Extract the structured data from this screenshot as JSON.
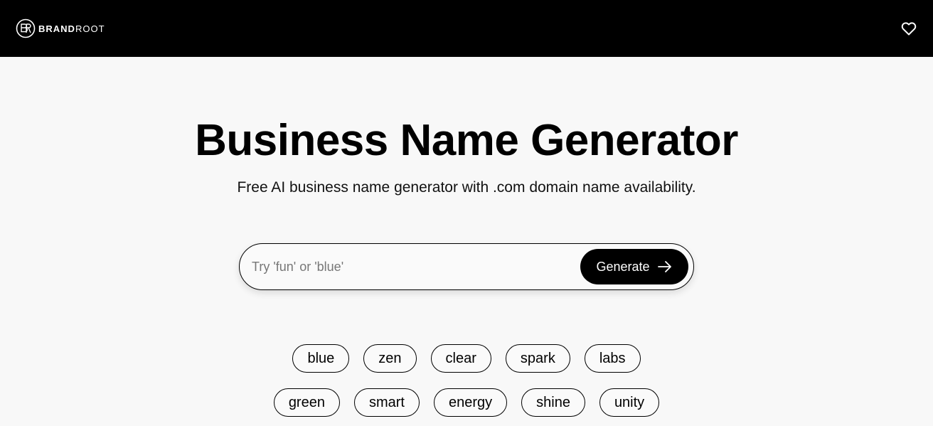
{
  "header": {
    "brand_bold": "BRAND",
    "brand_light": "ROOT",
    "favorites_icon": "heart-icon",
    "logo_icon": "brandroot-logo-mark"
  },
  "hero": {
    "title": "Business Name Generator",
    "subtitle": "Free AI business name generator with .com domain name availability."
  },
  "search": {
    "placeholder": "Try 'fun' or 'blue'",
    "value": "",
    "button_label": "Generate",
    "button_icon": "arrow-right-icon"
  },
  "suggestions": {
    "row1": [
      "blue",
      "zen",
      "clear",
      "spark",
      "labs"
    ],
    "row2": [
      "green",
      "smart",
      "energy",
      "shine",
      "unity"
    ]
  },
  "colors": {
    "header_bg": "#000000",
    "page_bg": "#f8f8f8",
    "button_bg": "#000000",
    "text": "#000000"
  }
}
